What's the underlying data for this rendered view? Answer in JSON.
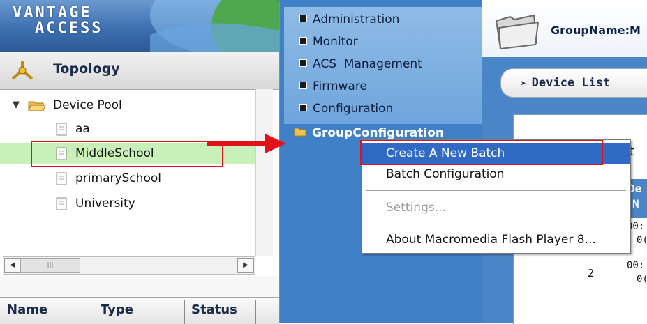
{
  "logo": {
    "line1": "VANTAGE",
    "line2": "ACCESS"
  },
  "topology": {
    "title": "Topology"
  },
  "tree": {
    "root": "Device Pool",
    "items": [
      "aa",
      "MiddleSchool",
      "primarySchool",
      "University"
    ]
  },
  "grid": {
    "columns": [
      "Name",
      "Type",
      "Status"
    ]
  },
  "nav": {
    "items": [
      "Administration",
      "Monitor",
      "ACS  Management",
      "Firmware",
      "Configuration"
    ],
    "group_configuration": "GroupConfiguration"
  },
  "right": {
    "group_name": "GroupName:M",
    "tab": "Device List",
    "partial": {
      "t": "t",
      "de": "De",
      "n": "N",
      "row1_code": "00:",
      "row1_sub": "0(",
      "row2_num": "2",
      "row2_code": "00:",
      "row2_sub": "0("
    }
  },
  "context_menu": {
    "items": [
      "Create A New Batch",
      "Batch Configuration",
      "Settings...",
      "About Macromedia Flash Player 8..."
    ]
  },
  "colors": {
    "highlight_red": "#e3121a",
    "menu_selection": "#316ac5",
    "nav_blue": "#3f80c6",
    "selected_row": "#c9f0b8"
  }
}
